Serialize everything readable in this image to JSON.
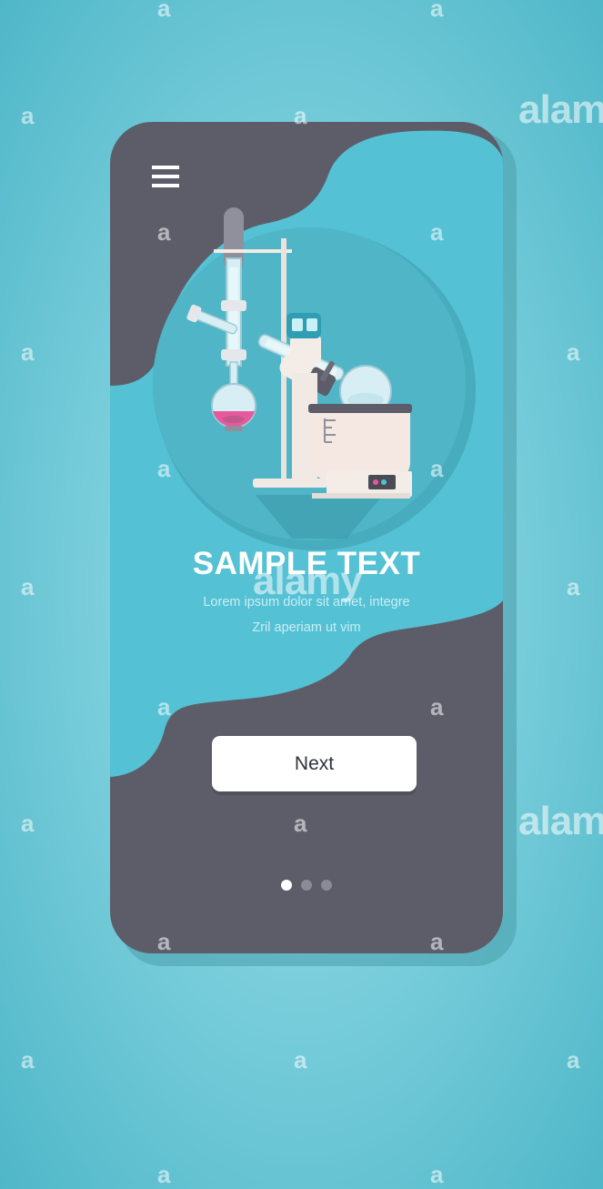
{
  "colors": {
    "page_background": "#7ccfdc",
    "phone_frame": "#5c5d69",
    "screen_accent": "#55c1d4",
    "button_background": "#ffffff",
    "dot_inactive": "#8a8b96",
    "dot_active": "#ffffff",
    "flask_liquid": "#e8589e"
  },
  "header": {
    "menu_icon": "hamburger-menu-icon"
  },
  "illustration": {
    "subject": "rotary-evaporator-icon"
  },
  "content": {
    "title": "SAMPLE TEXT",
    "subtitle_line1": "Lorem ipsum dolor sit amet, integre",
    "subtitle_line2": "Zril aperiam ut vim"
  },
  "actions": {
    "next_label": "Next"
  },
  "pagination": {
    "total": 3,
    "active": 1
  },
  "watermark": {
    "word": "alamy",
    "letter": "a"
  }
}
